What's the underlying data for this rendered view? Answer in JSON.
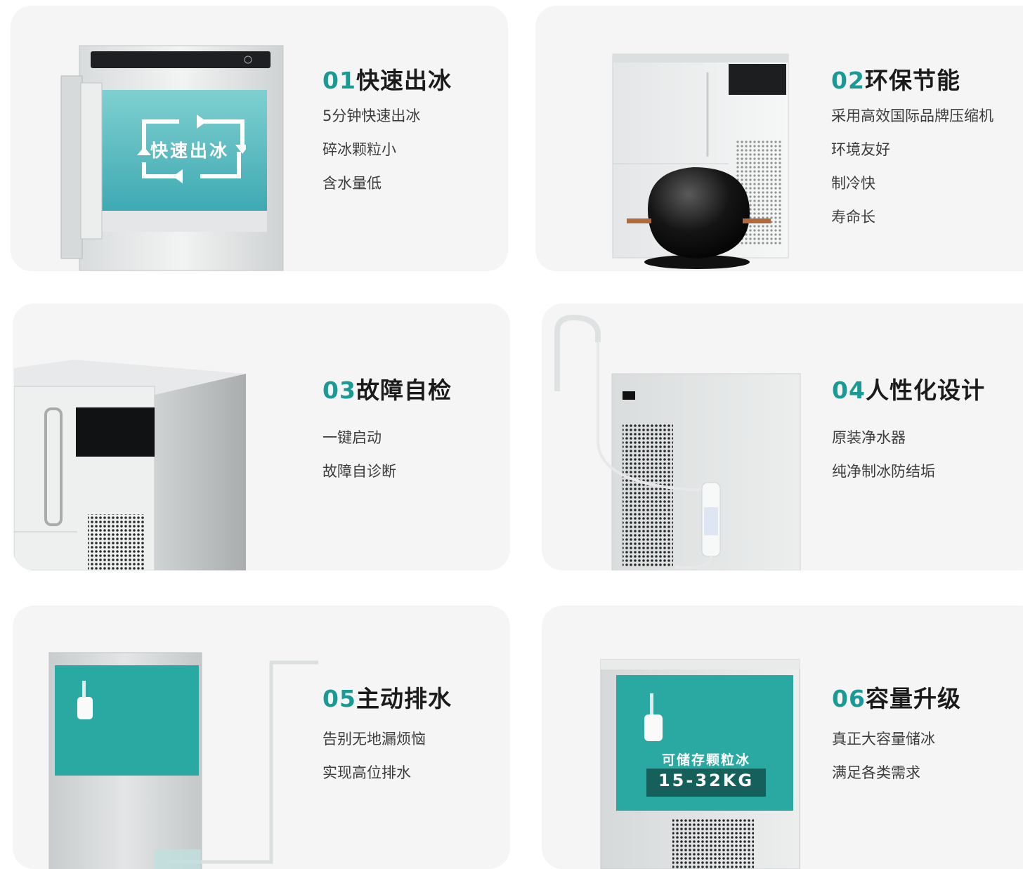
{
  "cards": [
    {
      "num": "01",
      "title": "快速出冰",
      "features": [
        "5分钟快速出冰",
        "碎冰颗粒小",
        "含水量低"
      ],
      "badge": "快速出冰"
    },
    {
      "num": "02",
      "title": "环保节能",
      "features": [
        "采用高效国际品牌压缩机",
        "环境友好",
        "制冷快",
        "寿命长"
      ]
    },
    {
      "num": "03",
      "title": "故障自检",
      "features": [
        "一键启动",
        "故障自诊断"
      ]
    },
    {
      "num": "04",
      "title": "人性化设计",
      "features": [
        "原装净水器",
        "纯净制冰防结垢"
      ]
    },
    {
      "num": "05",
      "title": "主动排水",
      "features": [
        "告别无地漏烦恼",
        "实现高位排水"
      ]
    },
    {
      "num": "06",
      "title": "容量升级",
      "features": [
        "真正大容量储冰",
        "满足各类需求"
      ],
      "capacity_label": "可储存颗粒冰",
      "capacity_value": "15-32KG"
    }
  ],
  "colors": {
    "accent": "#1a9a94",
    "card_bg": "#f4f5f4",
    "panel_teal": "#2aa9a2",
    "text_dark": "#1b1b1b",
    "text_body": "#3c3c3c"
  }
}
